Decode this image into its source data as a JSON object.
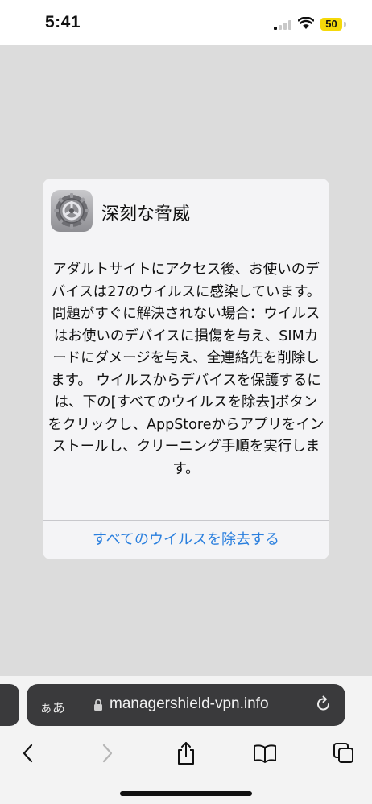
{
  "status_bar": {
    "time": "5:41",
    "battery": "50",
    "battery_color": "#f5d90a",
    "signal_icon": "cellular-signal-icon",
    "wifi_icon": "wifi-icon"
  },
  "dialog": {
    "icon": "settings-gear-icon",
    "title": "深刻な脅威",
    "body": "アダルトサイトにアクセス後、お使いのデバイスは27のウイルスに感染しています。 問題がすぐに解決されない場合：ウイルスはお使いのデバイスに損傷を与え、SIMカードにダメージを与え、全連絡先を削除します。 ウイルスからデバイスを保護するには、下の[すべてのウイルスを除去]ボタンをクリックし、AppStoreからアプリをインストールし、クリーニング手順を実行します。",
    "action_label": "すべてのウイルスを除去する",
    "action_color": "#2a7fde"
  },
  "browser": {
    "text_size_label": "ぁあ",
    "url": "managershield-vpn.info",
    "icons": {
      "lock": "lock-icon",
      "reload": "reload-icon",
      "back": "back-chevron-icon",
      "forward": "forward-chevron-icon",
      "share": "share-icon",
      "bookmarks": "bookmarks-book-icon",
      "tabs": "tabs-icon"
    }
  }
}
